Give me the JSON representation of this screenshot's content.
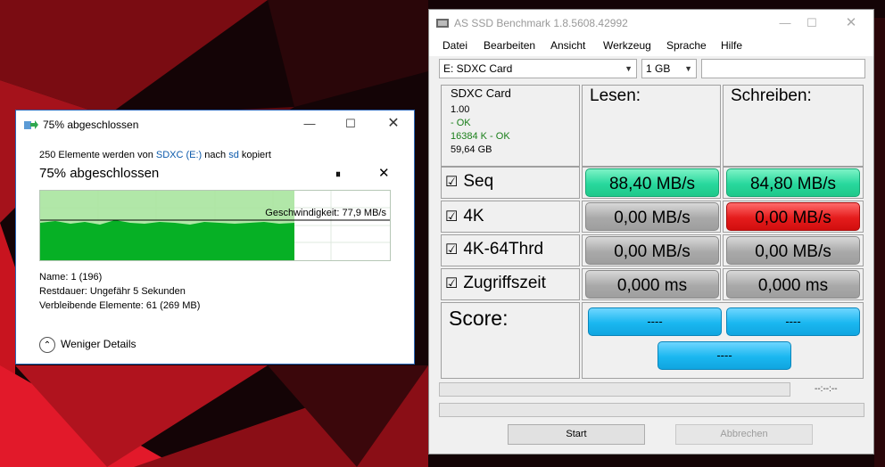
{
  "copy_dialog": {
    "title": "75% abgeschlossen",
    "line_prefix": "250 Elemente werden von ",
    "source": "SDXC (E:)",
    "line_mid": " nach ",
    "target": "sd",
    "line_suffix": " kopiert",
    "percent_heading": "75% abgeschlossen",
    "progress": 0.75,
    "speed": "Geschwindigkeit: 77,9 MB/s",
    "name": "Name:  1 (196)",
    "remaining_time": "Restdauer:  Ungefähr 5 Sekunden",
    "remaining_items": "Verbleibende Elemente:  61 (269 MB)",
    "less_details": "Weniger Details",
    "pause_glyph": "⏸",
    "close_glyph": "✕",
    "accent_color": "#06b025"
  },
  "ssd": {
    "title": "AS SSD Benchmark 1.8.5608.42992",
    "menu": [
      "Datei",
      "Bearbeiten",
      "Ansicht",
      "Werkzeug",
      "Sprache",
      "Hilfe"
    ],
    "drive_select": "E: SDXC Card",
    "size_select": "1 GB",
    "text_field": "",
    "drive": {
      "name": "SDXC Card",
      "version": "1.00",
      "status1": " - OK",
      "status2": "16384 K - OK",
      "capacity": "59,64 GB"
    },
    "col_read": "Lesen:",
    "col_write": "Schreiben:",
    "rows": [
      {
        "label": "Seq",
        "read": "88,40 MB/s",
        "write": "84,80 MB/s"
      },
      {
        "label": "4K",
        "read": "0,00 MB/s",
        "write": "0,00 MB/s"
      },
      {
        "label": "4K-64Thrd",
        "read": "0,00 MB/s",
        "write": "0,00 MB/s"
      },
      {
        "label": "Zugriffszeit",
        "read": "0,000 ms",
        "write": "0,000 ms"
      }
    ],
    "checkbox_glyph": "☑",
    "score_label": "Score:",
    "score_read": "----",
    "score_write": "----",
    "score_total": "----",
    "time_label": "--:--:--",
    "start_button": "Start",
    "abort_button": "Abbrechen",
    "colors": {
      "green": "#28d89d",
      "red": "#e51c1c",
      "gray": "#a9a9a9",
      "blue": "#1ab7f0"
    }
  }
}
